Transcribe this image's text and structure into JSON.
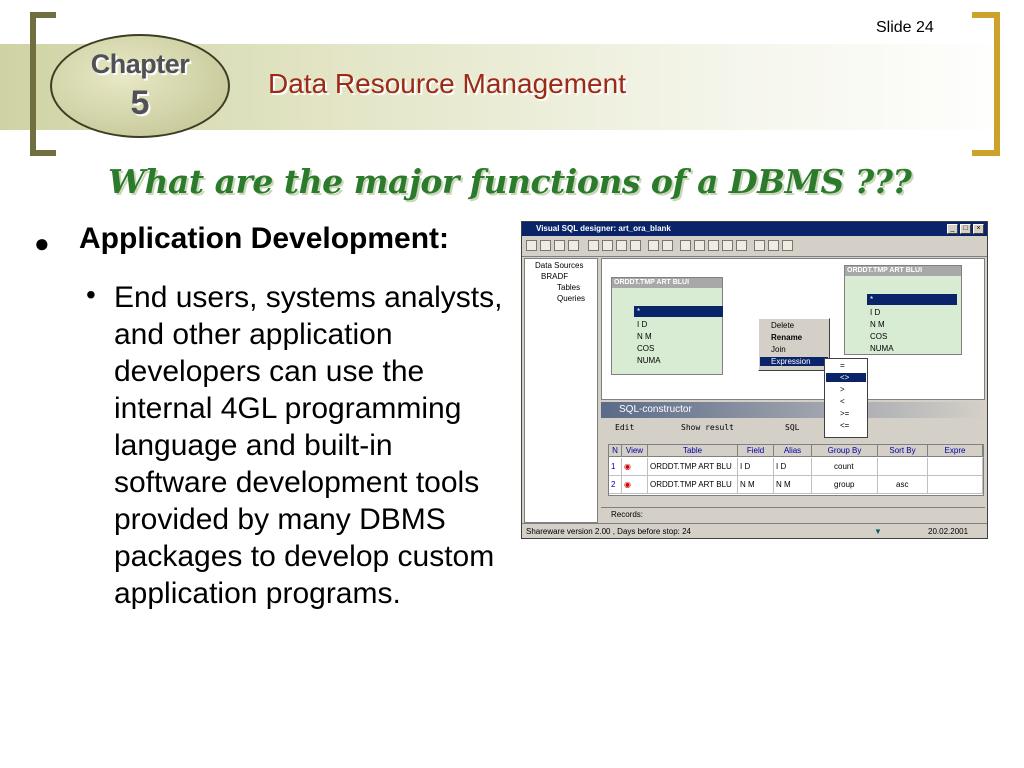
{
  "slide": {
    "slide_number": "Slide 24",
    "chapter_label": "Chapter",
    "chapter_number": "5",
    "header_title": "Data Resource Management",
    "title": "What are the major functions of a DBMS ???",
    "bullet_heading": "Application Development:",
    "sub_bullet": "End users, systems analysts, and other application developers can use the internal 4GL programming language and built-in software development tools provided by many DBMS packages to develop custom application programs."
  },
  "colors": {
    "header_title": "#9b2a18",
    "main_title": "#2c7a2c",
    "left_bracket": "#6f6f40",
    "right_bracket": "#cca22a",
    "band": "#cfd3a4"
  },
  "screenshot": {
    "window_title": "Visual SQL designer: art_ora_blank",
    "tree": [
      "Data Sources",
      "BRADF",
      "Tables",
      "Queries"
    ],
    "table_left": {
      "caption": "ORDDT.TMP ART BLUI",
      "selected": "*",
      "fields": [
        "I D",
        "N M",
        "COS",
        "NUMA"
      ]
    },
    "table_right": {
      "caption": "ORDDT.TMP ART BLUI",
      "selected": "*",
      "fields": [
        "I D",
        "N M",
        "COS",
        "NUMA"
      ]
    },
    "context_menu": [
      "Delete",
      "Rename",
      "Join",
      "Expression"
    ],
    "operators": [
      "=",
      "<>",
      ">",
      "<",
      ">=",
      "<="
    ],
    "sql_constructor": "SQL-constructor",
    "tabs": [
      "Edit",
      "Show result",
      "SQL"
    ],
    "grid_headers": [
      "N",
      "View",
      "Table",
      "Field",
      "Alias",
      "Group By",
      "Sort By",
      "Expre"
    ],
    "grid_rows": [
      {
        "n": "1",
        "table": "ORDDT.TMP ART BLU",
        "field": "I D",
        "alias": "I D",
        "group": "count",
        "sort": ""
      },
      {
        "n": "2",
        "table": "ORDDT.TMP ART BLU",
        "field": "N M",
        "alias": "N M",
        "group": "group",
        "sort": "asc"
      }
    ],
    "records_label": "Records:",
    "status_left": "Shareware version 2.00 , Days before stop: 24",
    "status_right": "20.02.2001"
  }
}
